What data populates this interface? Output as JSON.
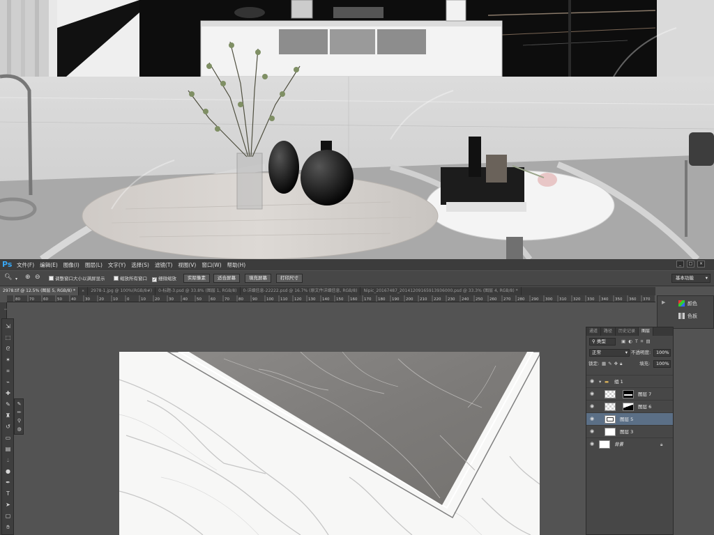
{
  "app": {
    "logo": "Ps",
    "menu": [
      "文件(F)",
      "编辑(E)",
      "图像(I)",
      "图层(L)",
      "文字(Y)",
      "选择(S)",
      "滤镜(T)",
      "视图(V)",
      "窗口(W)",
      "帮助(H)"
    ],
    "window_controls": [
      "_",
      "□",
      "×"
    ]
  },
  "options_bar": {
    "checkbox_resize": "调整窗口大小以满屏显示",
    "checkbox_zoom_all": "缩放所有窗口",
    "checkbox_scrubby": "细微缩放",
    "btn_actual": "实际像素",
    "btn_fit": "适合屏幕",
    "btn_fill": "填充屏幕",
    "btn_print": "打印尺寸",
    "workspace": "基本功能"
  },
  "doc_tabs": [
    "2978.tif @ 12.5% (图层 5, RGB/8) *",
    "2978-1.jpg @ 100%(RGB/8#)",
    "0-标题-3.psd @ 33.8% (图层 1, RGB/8)",
    "0-详细信息-22222.psd @ 16.7% (原文件详细信息, RGB/8)",
    "Nipic_20167487_20141209165913936000.psd @ 33.3% (图层 4, RGB/8) *"
  ],
  "ruler_ticks": [
    "80",
    "70",
    "60",
    "50",
    "40",
    "30",
    "20",
    "10",
    "0",
    "10",
    "20",
    "30",
    "40",
    "50",
    "60",
    "70",
    "80",
    "90",
    "100",
    "110",
    "120",
    "130",
    "140",
    "150",
    "160",
    "170",
    "180",
    "190",
    "200",
    "210",
    "220",
    "230",
    "240",
    "250",
    "260",
    "270",
    "280",
    "290",
    "300",
    "310",
    "320",
    "330",
    "340",
    "350",
    "360",
    "370",
    "380",
    "390",
    "400"
  ],
  "dock": {
    "color_label": "颜色",
    "swatch_label": "色板"
  },
  "layers_panel": {
    "tabs": [
      "通道",
      "路径",
      "历史记录",
      "图层"
    ],
    "filter_kind": "类型",
    "blend_mode": "正常",
    "opacity_label": "不透明度:",
    "opacity_value": "100%",
    "lock_label": "锁定:",
    "fill_label": "填充:",
    "fill_value": "100%",
    "group_name": "组 1",
    "layers": [
      "图层 7",
      "图层 6",
      "图层 5",
      "图层 3"
    ],
    "background_name": "背景"
  },
  "colors": {
    "ps_blue": "#38a6f2",
    "panel_bg": "#474747",
    "workspace_bg": "#535353",
    "selected_layer": "#5b6f86"
  }
}
